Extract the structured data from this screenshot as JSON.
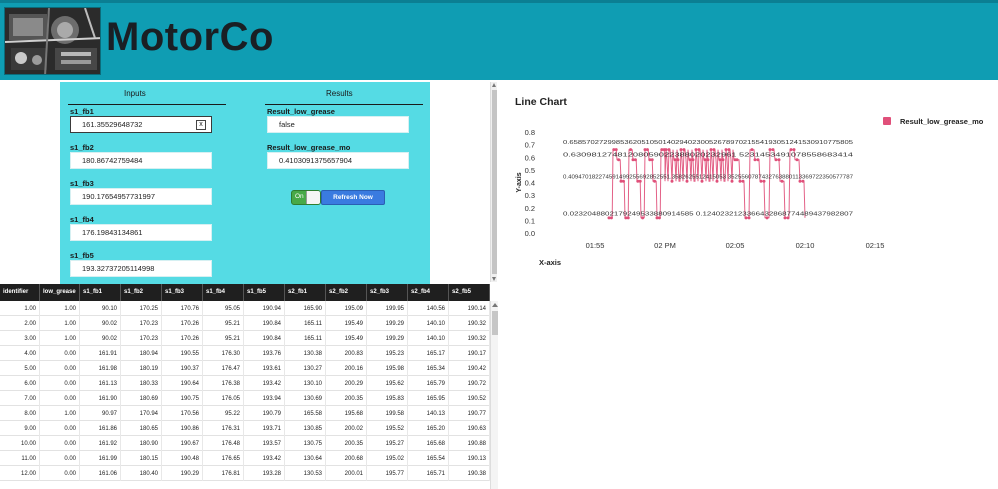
{
  "header": {
    "brand": "MotorCo",
    "logo": "engine-photo"
  },
  "inputs": {
    "title": "Inputs",
    "fields": [
      {
        "label": "s1_fb1",
        "value": "161.35529648732",
        "focused": true
      },
      {
        "label": "s1_fb2",
        "value": "180.86742759484"
      },
      {
        "label": "s1_fb3",
        "value": "190.17654957731997"
      },
      {
        "label": "s1_fb4",
        "value": "176.19843134861"
      },
      {
        "label": "s1_fb5",
        "value": "193.32737205114998"
      }
    ]
  },
  "results": {
    "title": "Results",
    "fields": [
      {
        "label": "Result_low_grease",
        "value": "false"
      },
      {
        "label": "Result_low_grease_mo",
        "value": "0.4103091375657904"
      }
    ]
  },
  "toggle": {
    "label": "On",
    "state": "on"
  },
  "refresh_label": "Refresh Now",
  "clear_symbol": "x",
  "colors": {
    "header": "#0f9db3",
    "panel": "#55dbe4",
    "series": "#e0507a",
    "button": "#3a7be0",
    "toggle": "#48a948"
  },
  "table": {
    "columns": [
      "identifier",
      "low_grease",
      "s1_fb1",
      "s1_fb2",
      "s1_fb3",
      "s1_fb4",
      "s1_fb5",
      "s2_fb1",
      "s2_fb2",
      "s2_fb3",
      "s2_fb4",
      "s2_fb5"
    ],
    "rows": [
      [
        "1.00",
        "1.00",
        "90.10",
        "170.25",
        "170.76",
        "95.05",
        "190.94",
        "165.90",
        "195.09",
        "199.95",
        "140.56",
        "190.14"
      ],
      [
        "2.00",
        "1.00",
        "90.02",
        "170.23",
        "170.26",
        "95.21",
        "190.84",
        "165.11",
        "195.49",
        "199.29",
        "140.10",
        "190.32"
      ],
      [
        "3.00",
        "1.00",
        "90.02",
        "170.23",
        "170.26",
        "95.21",
        "190.84",
        "165.11",
        "195.49",
        "199.29",
        "140.10",
        "190.32"
      ],
      [
        "4.00",
        "0.00",
        "161.91",
        "180.94",
        "190.55",
        "176.30",
        "193.76",
        "130.38",
        "200.83",
        "195.23",
        "165.17",
        "190.17"
      ],
      [
        "5.00",
        "0.00",
        "161.98",
        "180.19",
        "190.37",
        "176.47",
        "193.61",
        "130.27",
        "200.16",
        "195.98",
        "165.34",
        "190.42"
      ],
      [
        "6.00",
        "0.00",
        "161.13",
        "180.33",
        "190.64",
        "176.38",
        "193.42",
        "130.10",
        "200.29",
        "195.62",
        "165.79",
        "190.72"
      ],
      [
        "7.00",
        "0.00",
        "161.90",
        "180.69",
        "190.75",
        "176.05",
        "193.94",
        "130.69",
        "200.35",
        "195.83",
        "165.95",
        "190.52"
      ],
      [
        "8.00",
        "1.00",
        "90.97",
        "170.94",
        "170.56",
        "95.22",
        "190.79",
        "165.58",
        "195.68",
        "199.58",
        "140.13",
        "190.77"
      ],
      [
        "9.00",
        "0.00",
        "161.86",
        "180.65",
        "190.86",
        "176.31",
        "193.71",
        "130.85",
        "200.02",
        "195.52",
        "165.20",
        "190.63"
      ],
      [
        "10.00",
        "0.00",
        "161.92",
        "180.90",
        "190.67",
        "176.48",
        "193.57",
        "130.75",
        "200.35",
        "195.27",
        "165.68",
        "190.88"
      ],
      [
        "11.00",
        "0.00",
        "161.99",
        "180.15",
        "190.48",
        "176.65",
        "193.42",
        "130.64",
        "200.68",
        "195.02",
        "165.54",
        "190.13"
      ],
      [
        "12.00",
        "0.00",
        "161.06",
        "180.40",
        "190.29",
        "176.81",
        "193.28",
        "130.53",
        "200.01",
        "195.77",
        "165.71",
        "190.38"
      ]
    ]
  },
  "chart_data": {
    "type": "line",
    "title": "Line Chart",
    "xlabel": "X-axis",
    "ylabel": "Y-axis",
    "y_ticks": [
      "0.8",
      "0.7",
      "0.6",
      "0.5",
      "0.4",
      "0.3",
      "0.2",
      "0.1",
      "0.0"
    ],
    "x_ticks": [
      "01:55",
      "02 PM",
      "02:05",
      "02:10",
      "02:15"
    ],
    "ylim": [
      0,
      0.8
    ],
    "x_range": [
      "01:52",
      "02:15"
    ],
    "legend": {
      "position": "top-right",
      "entries": [
        "Result_low_grease_mo"
      ]
    },
    "grid": false,
    "series": [
      {
        "name": "Result_low_grease_mo",
        "segments": [
          {
            "start": "01:56",
            "end": "02:00",
            "levels": [
              0.12,
              0.41,
              0.58,
              0.66
            ]
          },
          {
            "start": "02:00",
            "end": "02:05",
            "levels": [
              0.41,
              0.58,
              0.66
            ]
          },
          {
            "start": "02:05",
            "end": "02:10",
            "levels": [
              0.12,
              0.41,
              0.58,
              0.66
            ]
          }
        ]
      }
    ],
    "point_labels": {
      "row_066": "0.6585702729985362051050140294023005267897021554193051241530910775805",
      "row_058": "0.63098127481208059022388020232961 5231453491078558683414",
      "row_041": "0.409470182274591499255692852551.3582625512415053 3525560787432763880113369722350577787",
      "row_012": "0.0232048802179249533880914585    0.1240232123366432868774489437982807"
    }
  }
}
